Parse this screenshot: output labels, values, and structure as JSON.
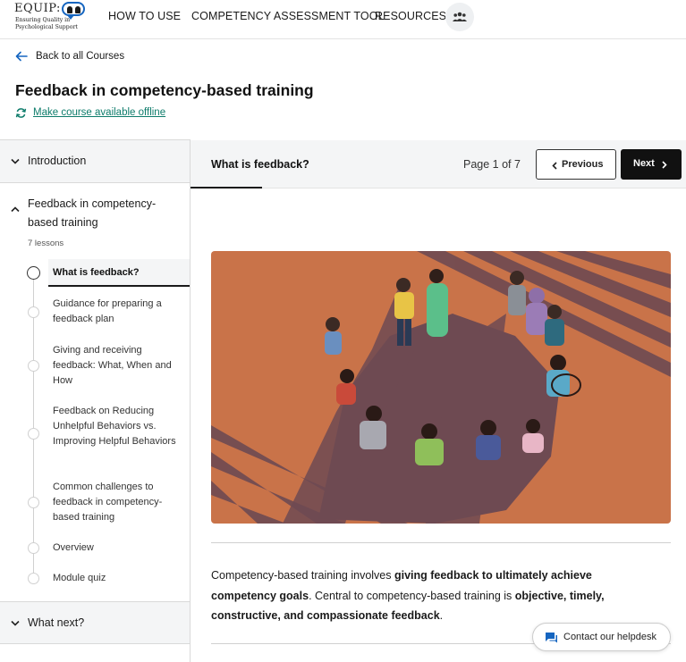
{
  "logo": {
    "wordmark": "EQUIP:",
    "tagline": "Ensuring Quality in Psychological Support"
  },
  "nav": {
    "how_to_use": "HOW TO USE",
    "competency_tool": "COMPETENCY ASSESSMENT TOOL",
    "resources": "RESOURCES",
    "people_icon": "people-icon"
  },
  "header": {
    "back_label": "Back to all Courses",
    "title": "Feedback in competency-based training",
    "offline_label": "Make course available offline"
  },
  "sidebar": {
    "intro_label": "Introduction",
    "current_section": {
      "label": "Feedback in competency-based training",
      "lesson_count": "7 lessons",
      "lessons": [
        {
          "label": "What is feedback?",
          "active": true
        },
        {
          "label": "Guidance for preparing a feedback plan",
          "active": false
        },
        {
          "label": "Giving and receiving feedback: What, When and How",
          "active": false
        },
        {
          "label": "Feedback on Reducing Unhelpful Behaviors vs. Improving Helpful Behaviors",
          "active": false
        },
        {
          "label": "Common challenges to feedback in competency-based training",
          "active": false
        },
        {
          "label": "Overview",
          "active": false
        },
        {
          "label": "Module quiz",
          "active": false
        }
      ]
    },
    "next_label": "What next?"
  },
  "lesson_bar": {
    "title": "What is feedback?",
    "page_indicator": "Page 1 of 7",
    "prev_label": "Previous",
    "next_label": "Next"
  },
  "content": {
    "p1_a": "Competency-based training involves ",
    "p1_b": "giving feedback to ultimately achieve competency goals",
    "p1_c": ". Central to competency-based training is ",
    "p1_d": "objective, timely, constructive, and compassionate feedback",
    "p1_e": "."
  },
  "helpdesk": {
    "label": "Contact our helpdesk"
  },
  "colors": {
    "accent_teal": "#0e7c6b",
    "hero_bg": "#c97349",
    "hero_shadow": "#6e4a52",
    "button_dark": "#111111"
  }
}
